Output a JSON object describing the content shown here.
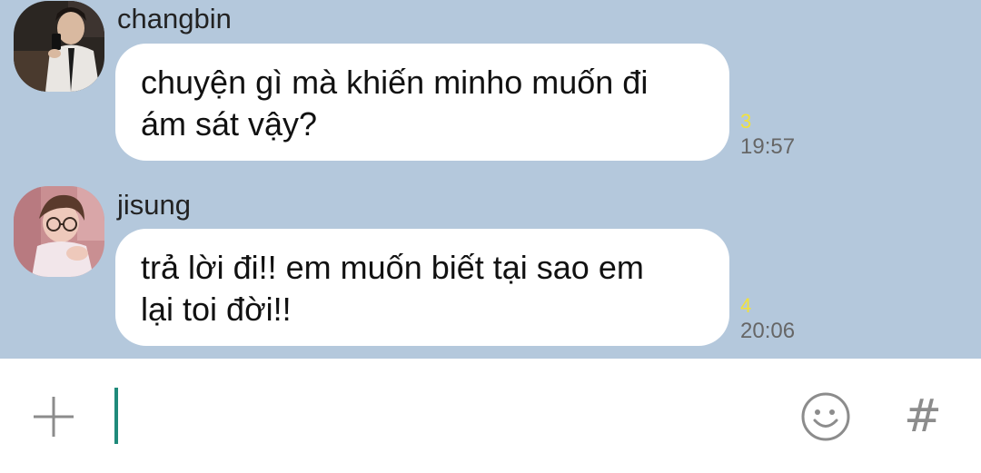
{
  "chat": {
    "messages": [
      {
        "sender": "changbin",
        "avatar_icon": "profile-photo",
        "text_lines": [
          "chuyện gì mà khiến minho muốn đi",
          "ám sát vậy?"
        ],
        "read_count": "3",
        "time": "19:57"
      },
      {
        "sender": "jisung",
        "avatar_icon": "profile-photo",
        "text_lines": [
          "trả lời đi!! em muốn biết tại sao em",
          "lại toi đời!!"
        ],
        "read_count": "4",
        "time": "20:06"
      }
    ]
  },
  "input_bar": {
    "plus_icon": "plus-icon",
    "message_value": "",
    "emoji_icon": "emoji-icon",
    "hash_label": "#"
  },
  "colors": {
    "chat_background": "#b4c8dc",
    "bubble": "#ffffff",
    "read_count": "#f2e23a",
    "cursor": "#1f8a7a"
  }
}
